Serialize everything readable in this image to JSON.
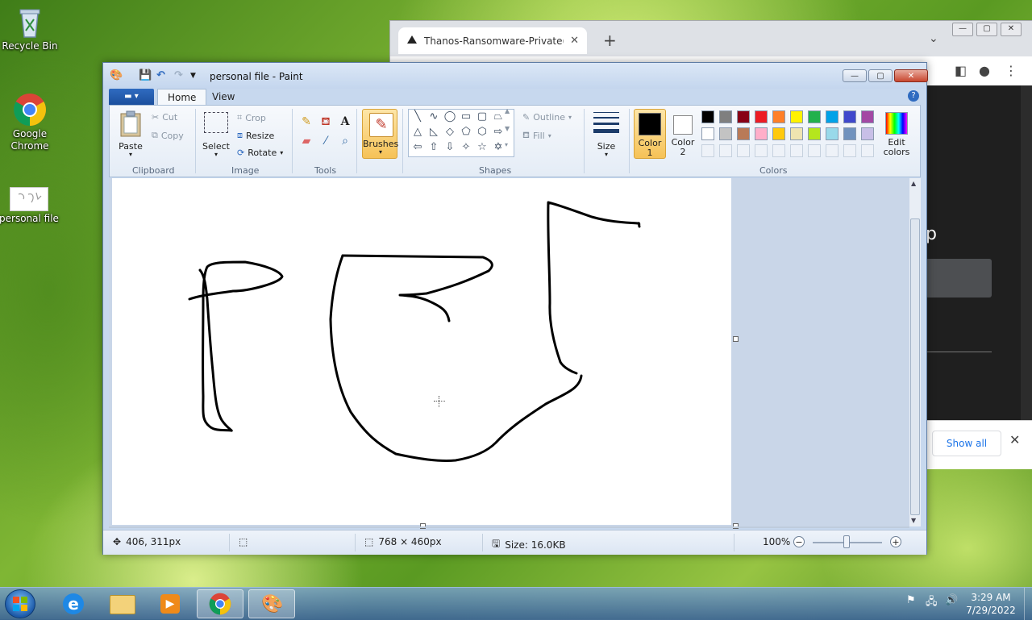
{
  "desktop": {
    "icons": [
      {
        "label": "Recycle Bin"
      },
      {
        "label": "Google Chrome"
      },
      {
        "label": "personal file"
      }
    ]
  },
  "chrome": {
    "tab_title": "Thanos-Ransomware-Private(Bui",
    "tab_close": "✕",
    "new_tab": "+",
    "page_text": "p",
    "download_bar": {
      "show_all": "Show all",
      "close": "✕"
    }
  },
  "paint": {
    "title": "personal file - Paint",
    "ribbon_tabs": [
      "Home",
      "View"
    ],
    "groups": {
      "clipboard": {
        "label": "Clipboard",
        "paste": "Paste",
        "cut": "Cut",
        "copy": "Copy"
      },
      "image": {
        "label": "Image",
        "select": "Select",
        "crop": "Crop",
        "resize": "Resize",
        "rotate": "Rotate"
      },
      "tools": {
        "label": "Tools"
      },
      "brushes": {
        "label": "Brushes"
      },
      "shapes": {
        "label": "Shapes",
        "outline": "Outline",
        "fill": "Fill"
      },
      "size": {
        "label": "Size"
      },
      "colors": {
        "label": "Colors",
        "color1": "Color 1",
        "color2": "Color 2",
        "edit_colors": "Edit colors",
        "color1_value": "#000000",
        "color2_value": "#ffffff",
        "palette_row1": [
          "#000000",
          "#7f7f7f",
          "#880015",
          "#ed1c24",
          "#ff7f27",
          "#fff200",
          "#22b14c",
          "#00a2e8",
          "#3f48cc",
          "#a349a4"
        ],
        "palette_row2": [
          "#ffffff",
          "#c3c3c3",
          "#b97a57",
          "#ffaec9",
          "#ffc90e",
          "#efe4b0",
          "#b5e61d",
          "#99d9ea",
          "#7092be",
          "#c8bfe7"
        ]
      }
    },
    "status": {
      "cursor_pos": "406, 311px",
      "canvas_size": "768 × 460px",
      "file_size": "Size: 16.0KB",
      "zoom": "100%"
    }
  },
  "taskbar": {
    "clock_time": "3:29 AM",
    "clock_date": "7/29/2022"
  }
}
